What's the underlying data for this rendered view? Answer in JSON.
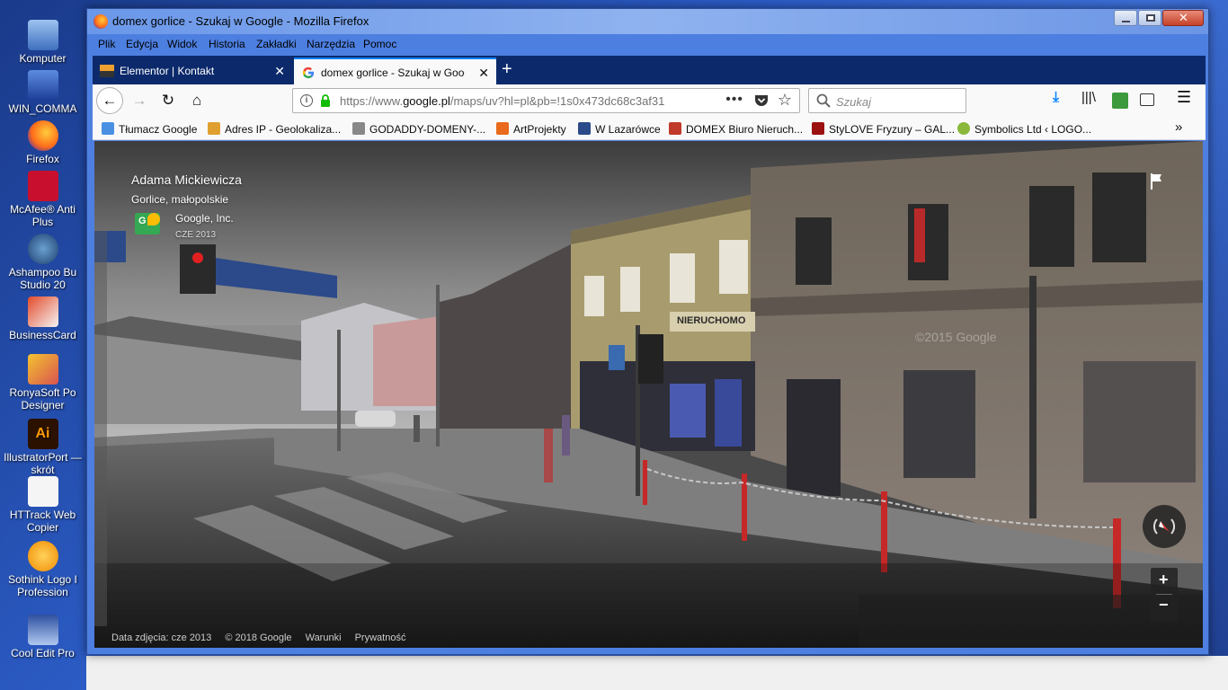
{
  "desktop": {
    "icons": [
      {
        "label": "Komputer"
      },
      {
        "label": "WIN_COMMA"
      },
      {
        "label": "Firefox"
      },
      {
        "label": "McAfee® Anti Plus"
      },
      {
        "label": "Ashampoo Bu Studio 20"
      },
      {
        "label": "BusinessCard"
      },
      {
        "label": "RonyaSoft Po Designer"
      },
      {
        "label": "IllustratorPort — skrót"
      },
      {
        "label": "HTTrack Web Copier"
      },
      {
        "label": "Sothink Logo I Profession"
      },
      {
        "label": "Cool Edit Pro"
      }
    ]
  },
  "window": {
    "title": "domex gorlice - Szukaj w Google - Mozilla Firefox"
  },
  "menu": [
    "Plik",
    "Edycja",
    "Widok",
    "Historia",
    "Zakładki",
    "Narzędzia",
    "Pomoc"
  ],
  "tabs": [
    {
      "label": "Elementor | Kontakt",
      "close": "✕"
    },
    {
      "label": "domex gorlice - Szukaj w Goog",
      "close": "✕"
    }
  ],
  "newtab": "+",
  "nav": {
    "url_prefix": "https://www.",
    "url_host": "google.pl",
    "url_rest": "/maps/uv?hl=pl&pb=!1s0x473dc68c3af31",
    "search_placeholder": "Szukaj"
  },
  "bookmarks": [
    {
      "label": "Tłumacz Google",
      "color": "#4a90e2"
    },
    {
      "label": "Adres IP - Geolokaliza...",
      "color": "#e0a030"
    },
    {
      "label": "GODADDY-DOMENY-...",
      "color": "#888888"
    },
    {
      "label": "ArtProjekty",
      "color": "#e86a1a"
    },
    {
      "label": "W Lazarówce",
      "color": "#2a4a8a"
    },
    {
      "label": "DOMEX Biuro Nieruch...",
      "color": "#c0392b"
    },
    {
      "label": "StyLOVE Fryzury – GAL...",
      "color": "#9b1010"
    },
    {
      "label": "Symbolics Ltd ‹ LOGO...",
      "color": "#8bb83a"
    }
  ],
  "streetview": {
    "street": "Adama Mickiewicza",
    "city": "Gorlice, małopolskie",
    "provider": "Google, Inc.",
    "date": "CZE 2013",
    "footer": {
      "photo_date": "Data zdjęcia: cze 2013",
      "copyright": "© 2018 Google",
      "terms": "Warunki",
      "privacy": "Prywatność"
    },
    "watermark": "©2015 Google",
    "shop_sign": "NIERUCHOMO",
    "zoom_in": "+",
    "zoom_out": "−"
  }
}
